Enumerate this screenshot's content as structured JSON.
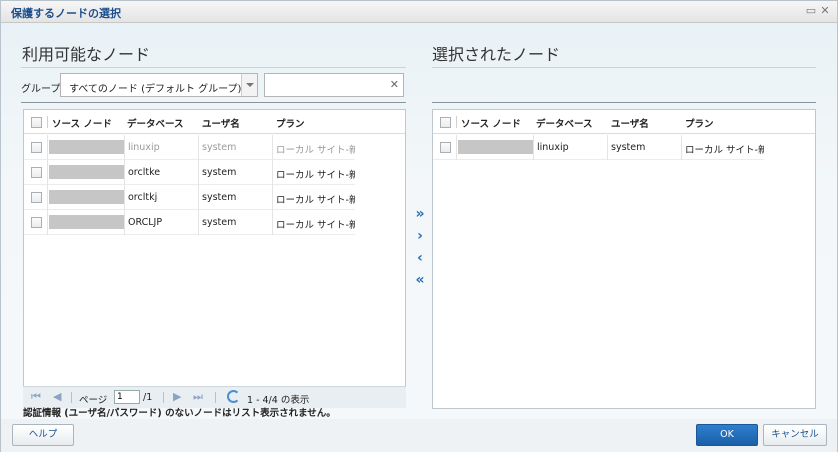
{
  "dialog": {
    "title": "保護するノードの選択"
  },
  "available": {
    "section_title": "利用可能なノード",
    "group_label": "グループ",
    "group_value": "すべてのノード (デフォルト グループ)",
    "search_value": "",
    "columns": [
      "ソース ノード",
      "データベース",
      "ユーザ名",
      "プラン"
    ],
    "rows": [
      {
        "database": "linuxip",
        "user": "system",
        "plan": "ローカル サイト-新規",
        "dimmed": true
      },
      {
        "database": "orcltke",
        "user": "system",
        "plan": "ローカル サイト-新規",
        "dimmed": false
      },
      {
        "database": "orcltkj",
        "user": "system",
        "plan": "ローカル サイト-新規",
        "dimmed": false
      },
      {
        "database": "ORCLJP",
        "user": "system",
        "plan": "ローカル サイト-新規",
        "dimmed": false
      }
    ],
    "pager": {
      "page_label": "ページ",
      "page_value": "1",
      "page_total": "/1",
      "display": "1 - 4/4 の表示"
    },
    "note": "認証情報 (ユーザ名/パスワード) のないノードはリスト表示されません。"
  },
  "selected": {
    "section_title": "選択されたノード",
    "columns": [
      "ソース ノード",
      "データベース",
      "ユーザ名",
      "プラン"
    ],
    "rows": [
      {
        "database": "linuxip",
        "user": "system",
        "plan": "ローカル サイト-新規"
      }
    ]
  },
  "move_buttons": [
    "»",
    "›",
    "‹",
    "«"
  ],
  "buttons": {
    "help": "ヘルプ",
    "ok": "OK",
    "cancel": "キャンセル"
  },
  "colors": {
    "accent": "#1d4f8c",
    "primary_button": "#2f7fce",
    "masked_cell": "#c6c6c6"
  }
}
